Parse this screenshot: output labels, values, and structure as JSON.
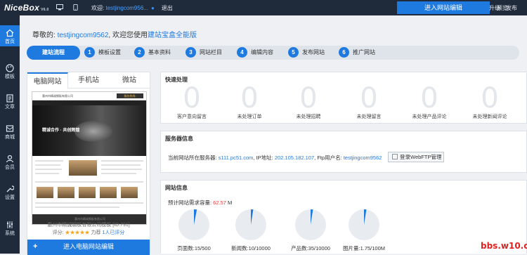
{
  "topbar": {
    "logo": "NiceBox",
    "logo_version": "V6.0",
    "welcome_prefix": "欢迎:",
    "username": "testjingcom956...",
    "logout": "退出",
    "edit_button": "进入网站编辑",
    "links": [
      "预览",
      "升级",
      "发布"
    ]
  },
  "sidebar": {
    "items": [
      {
        "label": "首页",
        "icon": "home-icon",
        "active": true
      },
      {
        "label": "模板",
        "icon": "palette-icon"
      },
      {
        "label": "文章",
        "icon": "document-icon"
      },
      {
        "label": "商城",
        "icon": "mall-icon"
      },
      {
        "label": "会员",
        "icon": "user-icon"
      },
      {
        "label": "设置",
        "icon": "wrench-icon"
      },
      {
        "label": "系统",
        "icon": "sliders-icon"
      }
    ]
  },
  "greeting": {
    "prefix": "尊敬的: ",
    "username": "testjingcom9562",
    "middle": ", 欢迎您使用",
    "product": "建站宝盒全能版"
  },
  "steps": {
    "current": "建站流程",
    "items": [
      {
        "n": "1",
        "label": "模板设置"
      },
      {
        "n": "2",
        "label": "基本资料"
      },
      {
        "n": "3",
        "label": "网站栏目"
      },
      {
        "n": "4",
        "label": "编辑内容"
      },
      {
        "n": "5",
        "label": "发布网站"
      },
      {
        "n": "6",
        "label": "推广网站"
      }
    ]
  },
  "site_tabs": [
    "电脑网站",
    "手机站",
    "微站"
  ],
  "template": {
    "logo_text": "惠州市精诚钢板有限公司",
    "hotline": "服务热线:",
    "banner_text": "精诚合作 · 共创辉煌",
    "footer_text": "惠州市精诚钢板有限公司",
    "name": "惠州市精诚钢板有限公司模板 [ID:791]",
    "rating_label": "评分:",
    "stars": "★★★★★",
    "score": "力荐",
    "raters": "1人已评分",
    "edit_button": "进入电脑网站编辑"
  },
  "quick": {
    "title": "快速处理",
    "items": [
      {
        "value": "0",
        "label": "客户意向留言"
      },
      {
        "value": "0",
        "label": "未处理订单"
      },
      {
        "value": "0",
        "label": "未处理招聘"
      },
      {
        "value": "0",
        "label": "未处理留言"
      },
      {
        "value": "0",
        "label": "未处理产品评论"
      },
      {
        "value": "0",
        "label": "未处理新闻评论"
      }
    ]
  },
  "server": {
    "title": "服务器信息",
    "server_label": "当前网站所在服务器: ",
    "server": "s111.pc51.com",
    "ip_label": ", IP地址: ",
    "ip": "202.105.182.107",
    "ftp_label": ", Ftp用户名: ",
    "ftp_user": "testjingcom9562",
    "ftp_button": "登录WebFTP管理"
  },
  "website": {
    "title": "网站信息",
    "capacity_label": "预计网站需求容量: ",
    "capacity_value": "62.57",
    "capacity_unit": " M",
    "pies": [
      {
        "label": "页面数:15/500",
        "fraction": 0.03
      },
      {
        "label": "新闻数:10/10000",
        "fraction": 0.001
      },
      {
        "label": "产品数:35/10000",
        "fraction": 0.0035
      },
      {
        "label": "图片量:1.75/100M",
        "fraction": 0.0175
      }
    ]
  },
  "watermark": "bbs.w10.cn",
  "colors": {
    "accent": "#1f7ae0",
    "dark": "#1f2a3a",
    "warn": "#e23c3c"
  }
}
